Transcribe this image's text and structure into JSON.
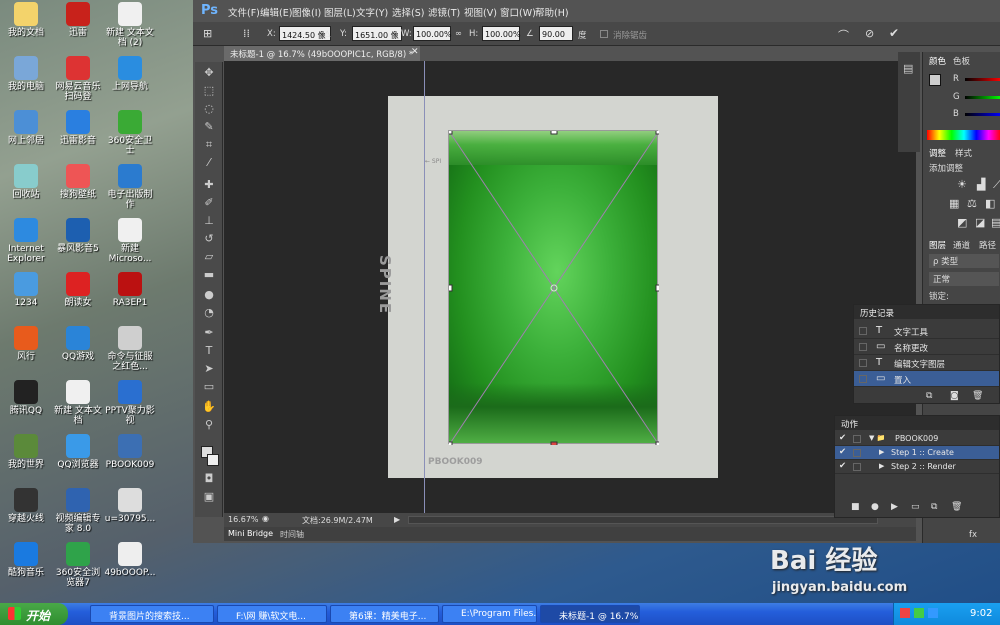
{
  "desktop": {
    "icons": [
      {
        "label": "我的文档",
        "color": "#f3d36b"
      },
      {
        "label": "迅雷",
        "color": "#c8221b"
      },
      {
        "label": "新建 文本文档 (2)",
        "color": "#f0f0f0"
      },
      {
        "label": "我的电脑",
        "color": "#7aa7d8"
      },
      {
        "label": "网易云音乐扫码登",
        "color": "#d33"
      },
      {
        "label": "上网导航",
        "color": "#2a8de0"
      },
      {
        "label": "网上邻居",
        "color": "#4c8fd6"
      },
      {
        "label": "迅雷影音",
        "color": "#2a7fe0"
      },
      {
        "label": "360安全卫士",
        "color": "#3aaa35"
      },
      {
        "label": "回收站",
        "color": "#8cc"
      },
      {
        "label": "搜狗壁纸",
        "color": "#e55"
      },
      {
        "label": "电子出版制作",
        "color": "#2b7bcf"
      },
      {
        "label": "Internet Explorer",
        "color": "#2d8ae0"
      },
      {
        "label": "暴风影音5",
        "color": "#1d5fb0"
      },
      {
        "label": "新建 Microso...",
        "color": "#f0f0f0"
      },
      {
        "label": "1234",
        "color": "#4a9be0"
      },
      {
        "label": "朗读女",
        "color": "#d22"
      },
      {
        "label": "RA3EP1",
        "color": "#b11"
      },
      {
        "label": "风行",
        "color": "#e85b1c"
      },
      {
        "label": "QQ游戏",
        "color": "#2a84d8"
      },
      {
        "label": "命令与征服之红色...",
        "color": "#cfcfcf"
      },
      {
        "label": "腾讯QQ",
        "color": "#222"
      },
      {
        "label": "新建 文本文档",
        "color": "#f0f0f0"
      },
      {
        "label": "PPTV聚力影视",
        "color": "#2a6fd0"
      },
      {
        "label": "我的世界",
        "color": "#5b8a3a"
      },
      {
        "label": "QQ浏览器",
        "color": "#3a9ae8"
      },
      {
        "label": "PBOOK009",
        "color": "#3c6fb3"
      },
      {
        "label": "穿越火线",
        "color": "#333"
      },
      {
        "label": "视频编辑专家 8.0",
        "color": "#2f63b0"
      },
      {
        "label": "u=30795...",
        "color": "#ddd"
      },
      {
        "label": "酷狗音乐",
        "color": "#1a7ae0"
      },
      {
        "label": "360安全浏览器7",
        "color": "#2fa34a"
      },
      {
        "label": "49bOOOP...",
        "color": "#eee"
      }
    ]
  },
  "photoshop": {
    "logo": "Ps",
    "menus": [
      "文件(F)",
      "编辑(E)",
      "图像(I)",
      "图层(L)",
      "文字(Y)",
      "选择(S)",
      "滤镜(T)",
      "视图(V)",
      "窗口(W)",
      "帮助(H)"
    ],
    "options": {
      "x_label": "X:",
      "x_value": "1424.50 像",
      "y_label": "Y:",
      "y_value": "1651.00 像",
      "w_label": "W:",
      "w_value": "100.00%",
      "h_label": "H:",
      "h_value": "100.00%",
      "angle_value": "90.00",
      "angle_unit": "度",
      "antialias_label": "消除锯齿"
    },
    "doc_tab": "未标题-1 @ 16.7% (49bOOOPIC1c, RGB/8) *",
    "canvas": {
      "spine_text": "SPINE",
      "pbook_text": "PBOOK009",
      "guide_hint": "← SPI"
    },
    "status": {
      "zoom": "16.67%",
      "doc_info": "文档:26.9M/2.47M"
    },
    "bottom_tabs": [
      "Mini Bridge",
      "时间轴"
    ],
    "dock": {
      "color_tabs": [
        "颜色",
        "色板"
      ],
      "rgb": [
        "R",
        "G",
        "B"
      ],
      "adjust_tabs": [
        "调整",
        "样式"
      ],
      "adjust_add": "添加调整",
      "layers_tabs": [
        "图层",
        "通道",
        "路径"
      ],
      "kind": "ρ 类型",
      "blend": "正常",
      "lock": "锁定:",
      "fx": "fx"
    },
    "history": {
      "title": "历史记录",
      "items": [
        {
          "label": "文字工具",
          "icon": "T"
        },
        {
          "label": "名称更改",
          "icon": "▭"
        },
        {
          "label": "编辑文字图层",
          "icon": "T"
        },
        {
          "label": "置入",
          "icon": "▭"
        }
      ]
    },
    "actions": {
      "title": "动作",
      "items": [
        {
          "label": "PBOOK009",
          "prefix": "▼ 📁"
        },
        {
          "label": "Step 1 :: Create",
          "prefix": "▶"
        },
        {
          "label": "Step 2 :: Render",
          "prefix": "▶"
        }
      ]
    }
  },
  "taskbar": {
    "start": "开始",
    "tasks": [
      "背景图片的搜索技...",
      "F:\\网  赚\\软文电...",
      "第6课：精美电子...",
      "E:\\Program Files...",
      "未标题-1 @ 16.7%..."
    ],
    "clock": "9:02"
  },
  "watermark": {
    "brand": "Bai 经验",
    "url": "jingyan.baidu.com"
  }
}
